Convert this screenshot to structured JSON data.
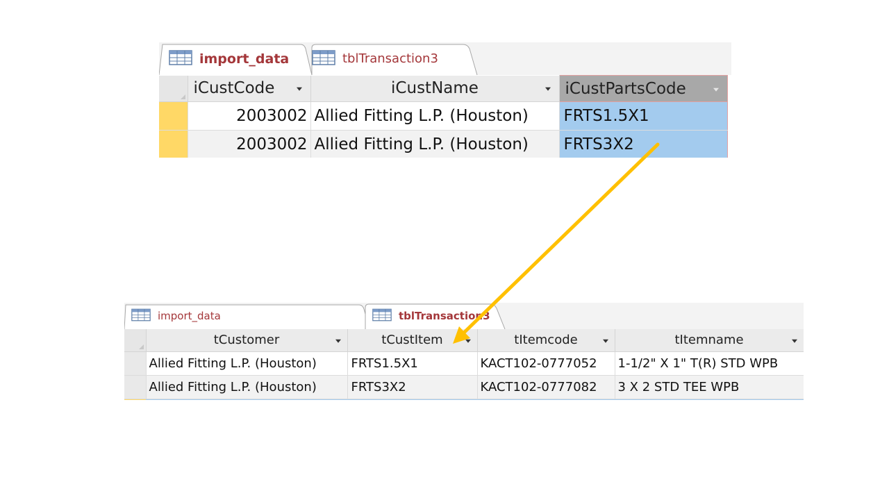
{
  "colors": {
    "tab_text": "#a4373a",
    "selected_cell": "#a3cbee",
    "row_selector_active": "#ffd866",
    "arrow": "#ffc000"
  },
  "top_window": {
    "tabs": [
      {
        "label": "import_data",
        "icon": "table-icon",
        "active": true
      },
      {
        "label": "tblTransaction3",
        "icon": "table-icon",
        "active": false
      }
    ],
    "columns": [
      "iCustCode",
      "iCustName",
      "iCustPartsCode"
    ],
    "selected_column": "iCustPartsCode",
    "rows": [
      [
        "2003002",
        "Allied Fitting L.P. (Houston)",
        "FRTS1.5X1"
      ],
      [
        "2003002",
        "Allied Fitting L.P. (Houston)",
        "FRTS3X2"
      ]
    ]
  },
  "bottom_window": {
    "tabs": [
      {
        "label": "import_data",
        "icon": "table-icon",
        "active": false
      },
      {
        "label": "tblTransaction3",
        "icon": "table-icon",
        "active": true
      }
    ],
    "columns": [
      "tCustomer",
      "tCustItem",
      "tItemcode",
      "tItemname"
    ],
    "rows": [
      [
        "Allied Fitting L.P. (Houston)",
        "FRTS1.5X1",
        "KACT102-0777052",
        "1-1/2\" X 1\" T(R) STD WPB"
      ],
      [
        "Allied Fitting L.P. (Houston)",
        "FRTS3X2",
        "KACT102-0777082",
        "3 X 2 STD TEE WPB"
      ]
    ]
  }
}
